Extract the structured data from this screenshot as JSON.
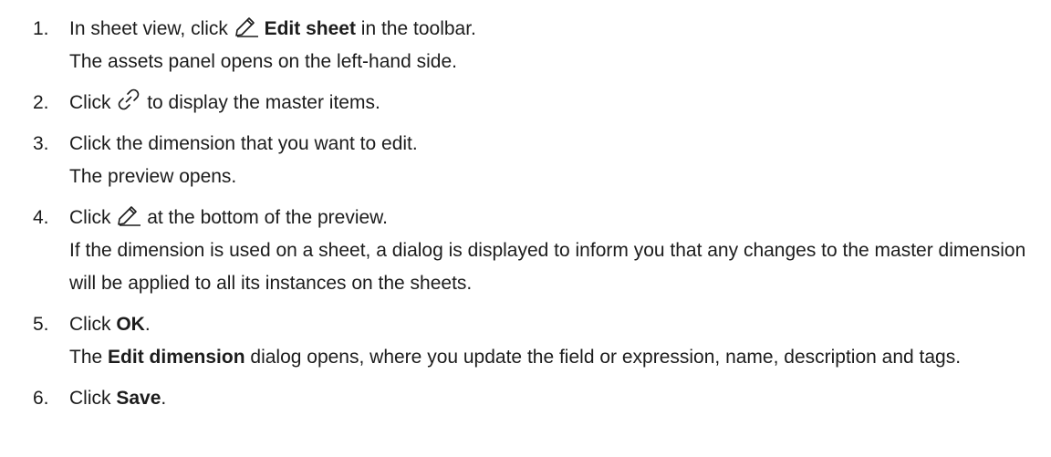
{
  "steps": [
    {
      "num": "1.",
      "a1": "In sheet view, click",
      "bold": "Edit sheet",
      "a2": "in the toolbar.",
      "note": "The assets panel opens on the left-hand side.",
      "icon": "pencil-icon"
    },
    {
      "num": "2.",
      "a1": "Click",
      "a2": "to display the master items.",
      "icon": "link-icon"
    },
    {
      "num": "3.",
      "text": "Click the dimension that you want to edit.",
      "note": "The preview opens."
    },
    {
      "num": "4.",
      "a1": "Click",
      "a2": "at the bottom of the preview.",
      "note": "If the dimension is used on a sheet, a dialog is displayed to inform you that any changes to the master dimension will be applied to all its instances on the sheets.",
      "icon": "pencil-icon"
    },
    {
      "num": "5.",
      "a1": "Click",
      "bold": "OK",
      "a2": ".",
      "note_bold": "Edit dimension",
      "note_rest": "dialog opens, where you update the field or expression, name, description and tags.",
      "note_pre": "The"
    },
    {
      "num": "6.",
      "a1": "Click",
      "bold": "Save",
      "a2": "."
    }
  ]
}
